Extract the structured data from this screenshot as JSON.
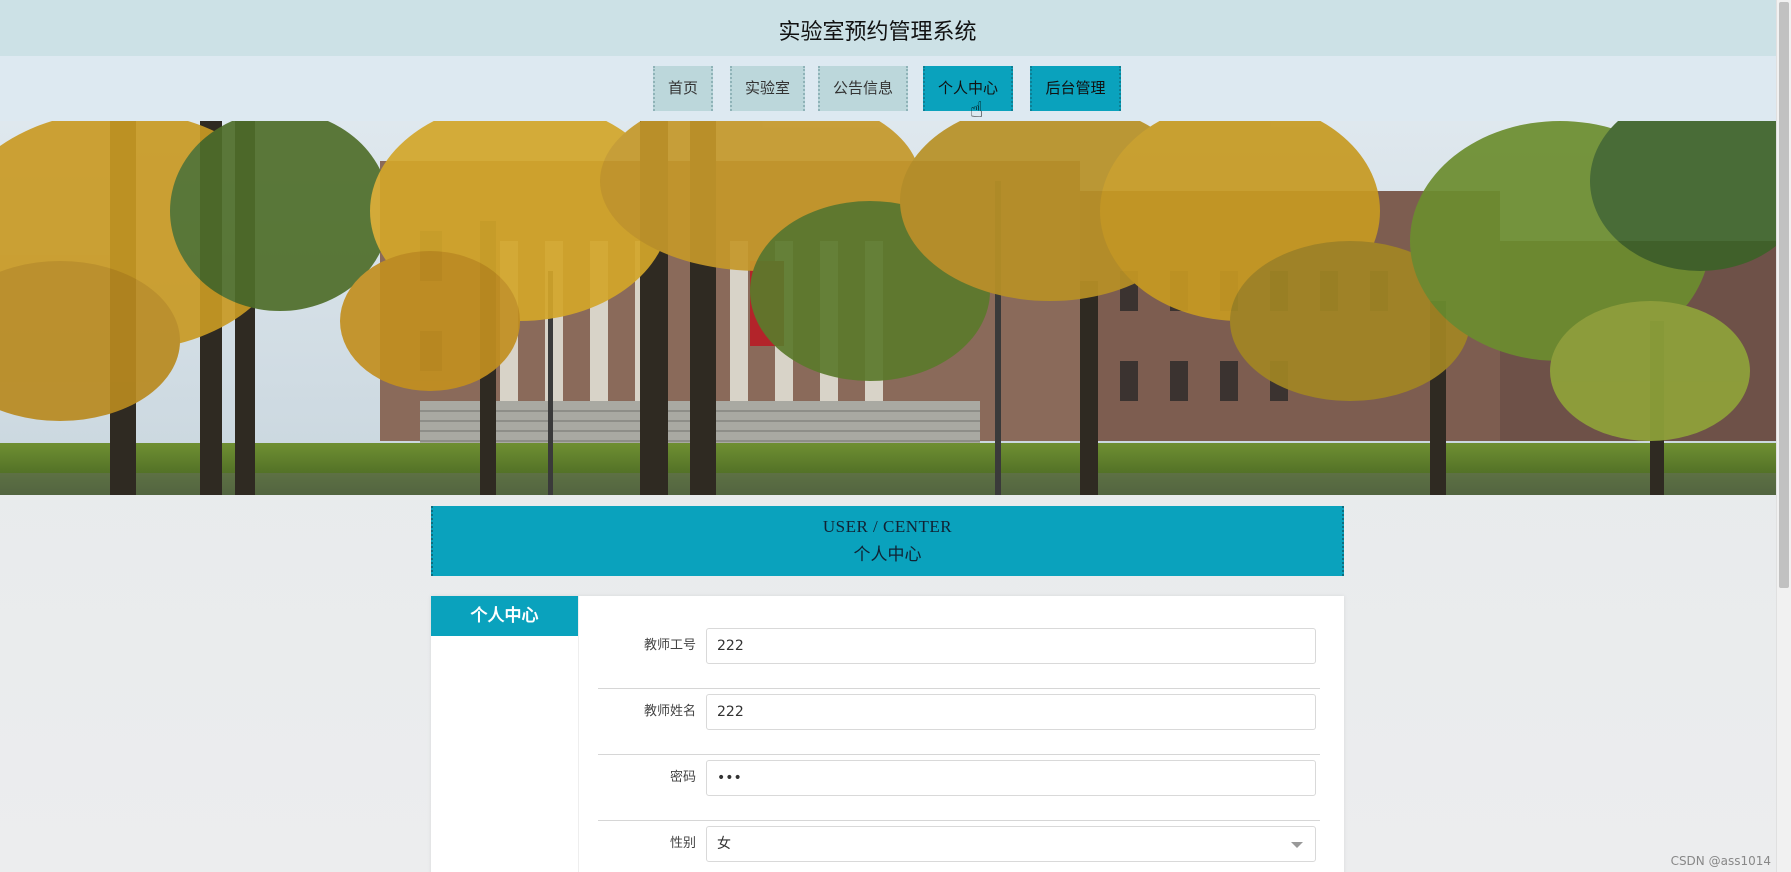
{
  "site": {
    "title": "实验室预约管理系统"
  },
  "nav": {
    "items": [
      "首页",
      "实验室",
      "公告信息",
      "个人中心",
      "后台管理"
    ]
  },
  "center": {
    "title_en": "USER / CENTER",
    "title_cn": "个人中心"
  },
  "sidebar": {
    "tab": "个人中心"
  },
  "form": {
    "teacher_id": {
      "label": "教师工号",
      "value": "222"
    },
    "teacher_name": {
      "label": "教师姓名",
      "value": "222"
    },
    "password": {
      "label": "密码",
      "value": "•••"
    },
    "gender": {
      "label": "性别",
      "value": "女"
    }
  },
  "watermark": "CSDN @ass1014",
  "colors": {
    "accent": "#0aa2bd",
    "header_bg": "#cce1e6",
    "nav_bg": "#dde9f1"
  }
}
